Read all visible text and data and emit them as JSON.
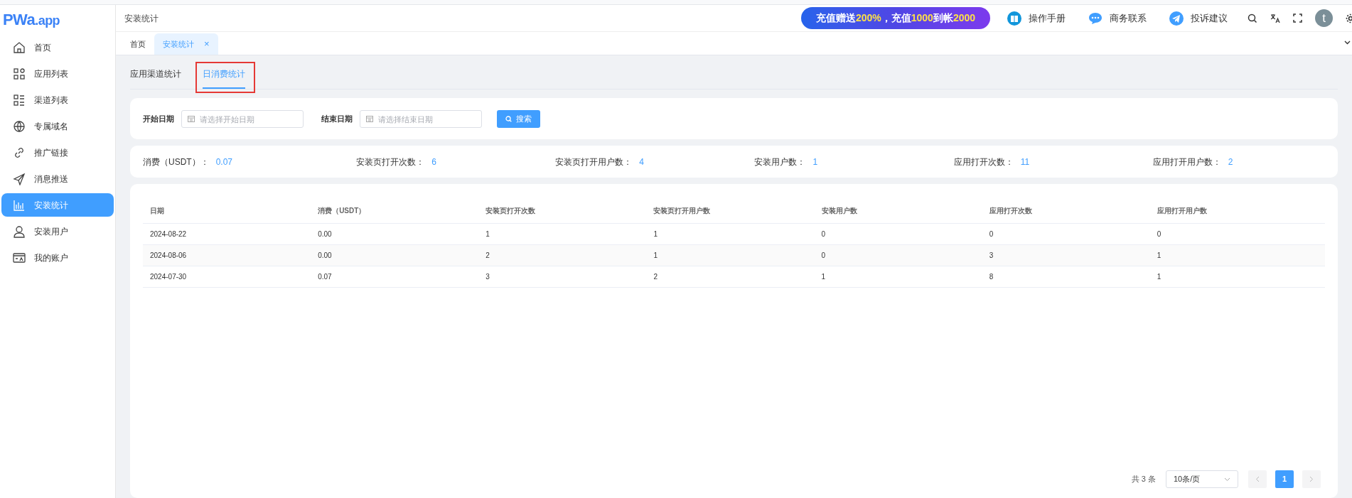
{
  "sidebar": {
    "logo": {
      "mark": "PWa",
      "suffix": ".app"
    },
    "items": [
      {
        "label": "首页",
        "selected": false
      },
      {
        "label": "应用列表",
        "selected": false
      },
      {
        "label": "渠道列表",
        "selected": false
      },
      {
        "label": "专属域名",
        "selected": false
      },
      {
        "label": "推广链接",
        "selected": false
      },
      {
        "label": "消息推送",
        "selected": false
      },
      {
        "label": "安装统计",
        "selected": true
      },
      {
        "label": "安装用户",
        "selected": false
      },
      {
        "label": "我的账户",
        "selected": false
      }
    ]
  },
  "header": {
    "breadcrumb": "安装统计",
    "banner": [
      {
        "text": "充值赠送",
        "highlight": false
      },
      {
        "text": "200%",
        "highlight": true
      },
      {
        "text": "，充值",
        "highlight": false
      },
      {
        "text": "1000",
        "highlight": true
      },
      {
        "text": "到帐",
        "highlight": false
      },
      {
        "text": "2000",
        "highlight": true
      }
    ],
    "links": [
      {
        "label": "操作手册"
      },
      {
        "label": "商务联系"
      },
      {
        "label": "投诉建议"
      }
    ],
    "avatar": "t"
  },
  "page_tabs": [
    {
      "label": "首页",
      "selected": false,
      "closable": false
    },
    {
      "label": "安装统计",
      "selected": true,
      "closable": true
    }
  ],
  "close_glyph": "×",
  "sub_tabs": [
    {
      "label": "应用渠道统计",
      "selected": false
    },
    {
      "label": "日消费统计",
      "selected": true
    }
  ],
  "filters": [
    {
      "label": "开始日期",
      "placeholder": "请选择开始日期"
    },
    {
      "label": "结束日期",
      "placeholder": "请选择结束日期"
    }
  ],
  "search_button": "搜索",
  "stats": [
    {
      "label": "消费（USDT）：",
      "value": "0.07"
    },
    {
      "label": "安装页打开次数：",
      "value": "6"
    },
    {
      "label": "安装页打开用户数：",
      "value": "4"
    },
    {
      "label": "安装用户数：",
      "value": "1"
    },
    {
      "label": "应用打开次数：",
      "value": "11"
    },
    {
      "label": "应用打开用户数：",
      "value": "2"
    }
  ],
  "table": {
    "columns": [
      "日期",
      "消费（USDT）",
      "安装页打开次数",
      "安装页打开用户数",
      "安装用户数",
      "应用打开次数",
      "应用打开用户数"
    ],
    "rows": [
      [
        "2024-08-22",
        "0.00",
        "1",
        "1",
        "0",
        "0",
        "0"
      ],
      [
        "2024-08-06",
        "0.00",
        "2",
        "1",
        "0",
        "3",
        "1"
      ],
      [
        "2024-07-30",
        "0.07",
        "3",
        "2",
        "1",
        "8",
        "1"
      ]
    ]
  },
  "pagination": {
    "total": "共 3 条",
    "page_size": "10条/页",
    "pages": [
      {
        "label": "1",
        "selected": true
      }
    ]
  }
}
